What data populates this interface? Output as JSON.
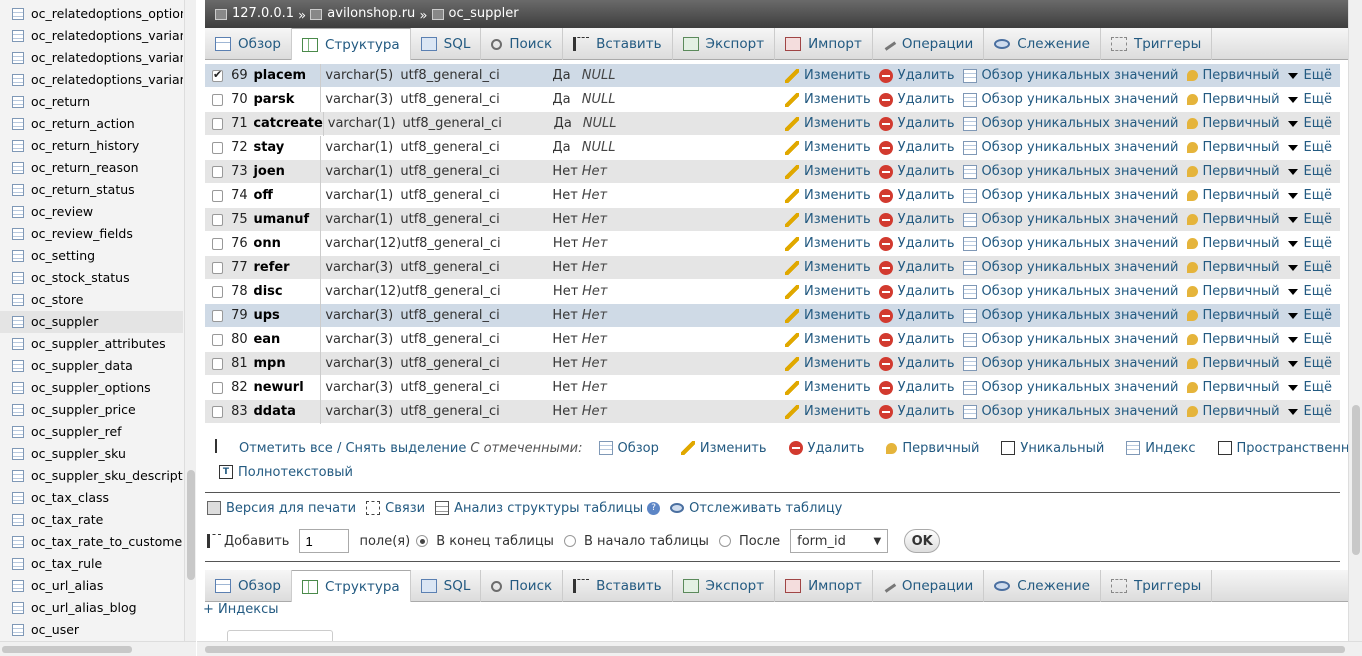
{
  "nav": {
    "items": [
      {
        "label": "oc_relatedoptions_option",
        "active": false
      },
      {
        "label": "oc_relatedoptions_variant",
        "active": false
      },
      {
        "label": "oc_relatedoptions_variant_",
        "active": false
      },
      {
        "label": "oc_relatedoptions_variant_",
        "active": false
      },
      {
        "label": "oc_return",
        "active": false
      },
      {
        "label": "oc_return_action",
        "active": false
      },
      {
        "label": "oc_return_history",
        "active": false
      },
      {
        "label": "oc_return_reason",
        "active": false
      },
      {
        "label": "oc_return_status",
        "active": false
      },
      {
        "label": "oc_review",
        "active": false
      },
      {
        "label": "oc_review_fields",
        "active": false
      },
      {
        "label": "oc_setting",
        "active": false
      },
      {
        "label": "oc_stock_status",
        "active": false
      },
      {
        "label": "oc_store",
        "active": false
      },
      {
        "label": "oc_suppler",
        "active": true
      },
      {
        "label": "oc_suppler_attributes",
        "active": false
      },
      {
        "label": "oc_suppler_data",
        "active": false
      },
      {
        "label": "oc_suppler_options",
        "active": false
      },
      {
        "label": "oc_suppler_price",
        "active": false
      },
      {
        "label": "oc_suppler_ref",
        "active": false
      },
      {
        "label": "oc_suppler_sku",
        "active": false
      },
      {
        "label": "oc_suppler_sku_descriptio",
        "active": false
      },
      {
        "label": "oc_tax_class",
        "active": false
      },
      {
        "label": "oc_tax_rate",
        "active": false
      },
      {
        "label": "oc_tax_rate_to_customer_",
        "active": false
      },
      {
        "label": "oc_tax_rule",
        "active": false
      },
      {
        "label": "oc_url_alias",
        "active": false
      },
      {
        "label": "oc_url_alias_blog",
        "active": false
      },
      {
        "label": "oc_user",
        "active": false
      }
    ]
  },
  "breadcrumb": {
    "server": "127.0.0.1",
    "database": "avilonshop.ru",
    "table": "oc_suppler",
    "separator": "»"
  },
  "tabs": [
    {
      "label": "Обзор",
      "icon": "browse-icon",
      "active": false
    },
    {
      "label": "Структура",
      "icon": "structure-icon",
      "active": true
    },
    {
      "label": "SQL",
      "icon": "sql-icon",
      "active": false
    },
    {
      "label": "Поиск",
      "icon": "search-icon",
      "active": false
    },
    {
      "label": "Вставить",
      "icon": "insert-icon",
      "active": false
    },
    {
      "label": "Экспорт",
      "icon": "export-icon",
      "active": false
    },
    {
      "label": "Импорт",
      "icon": "import-icon",
      "active": false
    },
    {
      "label": "Операции",
      "icon": "operations-icon",
      "active": false
    },
    {
      "label": "Слежение",
      "icon": "tracking-icon",
      "active": false
    },
    {
      "label": "Триггеры",
      "icon": "triggers-icon",
      "active": false
    }
  ],
  "row_actions": {
    "edit": "Изменить",
    "delete": "Удалить",
    "unique": "Обзор уникальных значений",
    "primary": "Первичный",
    "more": "Ещё"
  },
  "columns": [
    {
      "num": "69",
      "name": "placem",
      "type": "varchar(5)",
      "collation": "utf8_general_ci",
      "null": "Да",
      "default": "NULL",
      "checked": true,
      "highlight": true
    },
    {
      "num": "70",
      "name": "parsk",
      "type": "varchar(3)",
      "collation": "utf8_general_ci",
      "null": "Да",
      "default": "NULL",
      "checked": false,
      "highlight": false
    },
    {
      "num": "71",
      "name": "catcreate",
      "type": "varchar(1)",
      "collation": "utf8_general_ci",
      "null": "Да",
      "default": "NULL",
      "checked": false,
      "highlight": false
    },
    {
      "num": "72",
      "name": "stay",
      "type": "varchar(1)",
      "collation": "utf8_general_ci",
      "null": "Да",
      "default": "NULL",
      "checked": false,
      "highlight": false
    },
    {
      "num": "73",
      "name": "joen",
      "type": "varchar(1)",
      "collation": "utf8_general_ci",
      "null": "Нет",
      "default": "Нет",
      "checked": false,
      "highlight": false
    },
    {
      "num": "74",
      "name": "off",
      "type": "varchar(1)",
      "collation": "utf8_general_ci",
      "null": "Нет",
      "default": "Нет",
      "checked": false,
      "highlight": false
    },
    {
      "num": "75",
      "name": "umanuf",
      "type": "varchar(1)",
      "collation": "utf8_general_ci",
      "null": "Нет",
      "default": "Нет",
      "checked": false,
      "highlight": false
    },
    {
      "num": "76",
      "name": "onn",
      "type": "varchar(12)",
      "collation": "utf8_general_ci",
      "null": "Нет",
      "default": "Нет",
      "checked": false,
      "highlight": false
    },
    {
      "num": "77",
      "name": "refer",
      "type": "varchar(3)",
      "collation": "utf8_general_ci",
      "null": "Нет",
      "default": "Нет",
      "checked": false,
      "highlight": false
    },
    {
      "num": "78",
      "name": "disc",
      "type": "varchar(12)",
      "collation": "utf8_general_ci",
      "null": "Нет",
      "default": "Нет",
      "checked": false,
      "highlight": false
    },
    {
      "num": "79",
      "name": "ups",
      "type": "varchar(3)",
      "collation": "utf8_general_ci",
      "null": "Нет",
      "default": "Нет",
      "checked": false,
      "highlight": true
    },
    {
      "num": "80",
      "name": "ean",
      "type": "varchar(3)",
      "collation": "utf8_general_ci",
      "null": "Нет",
      "default": "Нет",
      "checked": false,
      "highlight": false
    },
    {
      "num": "81",
      "name": "mpn",
      "type": "varchar(3)",
      "collation": "utf8_general_ci",
      "null": "Нет",
      "default": "Нет",
      "checked": false,
      "highlight": false
    },
    {
      "num": "82",
      "name": "newurl",
      "type": "varchar(3)",
      "collation": "utf8_general_ci",
      "null": "Нет",
      "default": "Нет",
      "checked": false,
      "highlight": false
    },
    {
      "num": "83",
      "name": "ddata",
      "type": "varchar(3)",
      "collation": "utf8_general_ci",
      "null": "Нет",
      "default": "Нет",
      "checked": false,
      "highlight": false
    }
  ],
  "with_selected": {
    "check_all": "Отметить все / Снять выделение",
    "label": "С отмеченными:",
    "actions": [
      {
        "label": "Обзор",
        "icon": "browse-icon"
      },
      {
        "label": "Изменить",
        "icon": "edit-icon"
      },
      {
        "label": "Удалить",
        "icon": "delete-icon"
      },
      {
        "label": "Первичный",
        "icon": "primary-key-icon"
      },
      {
        "label": "Уникальный",
        "icon": "unique-icon"
      },
      {
        "label": "Индекс",
        "icon": "index-icon"
      },
      {
        "label": "Пространственный",
        "icon": "spatial-icon"
      }
    ],
    "fulltext": "Полнотекстовый"
  },
  "print_links": {
    "print": "Версия для печати",
    "relations": "Связи",
    "analyze": "Анализ структуры таблицы",
    "track": "Отслеживать таблицу"
  },
  "add_fields": {
    "label": "Добавить",
    "count": "1",
    "fields_label": "поле(я)",
    "at_end": "В конец таблицы",
    "at_begin": "В начало таблицы",
    "after": "После",
    "after_value": "form_id",
    "ok": "OK"
  },
  "indexes_link": "+ Индексы"
}
